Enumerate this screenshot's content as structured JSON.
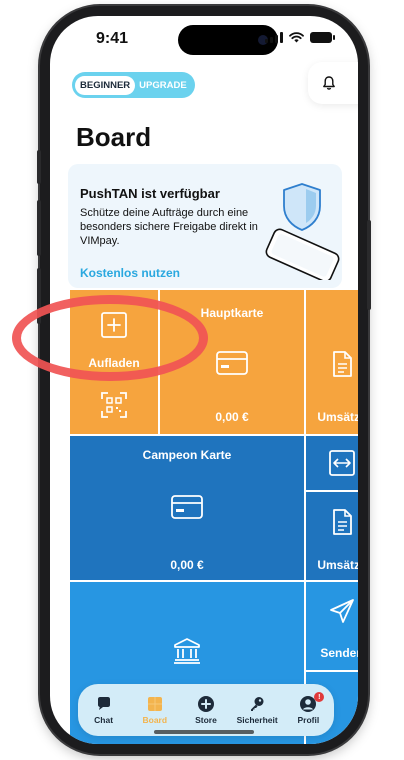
{
  "status_bar": {
    "time": "9:41"
  },
  "level": {
    "current": "BEGINNER",
    "upgrade": "UPGRADE"
  },
  "page_title": "Board",
  "promo": {
    "title": "PushTAN ist verfügbar",
    "text": "Schütze deine Aufträge durch eine besonders sichere Freigabe direkt in VIMpay.",
    "link": "Kostenlos nutzen"
  },
  "tiles": {
    "aufladen": "Aufladen",
    "hauptkarte_title": "Hauptkarte",
    "hauptkarte_balance": "0,00 €",
    "umsaetze_1": "Umsätze",
    "campeon_title": "Campeon Karte",
    "campeon_balance": "0,00 €",
    "umsaetze_2": "Umsätze",
    "senden": "Senden"
  },
  "tabbar": [
    {
      "label": "Chat",
      "icon": "chat-icon"
    },
    {
      "label": "Board",
      "icon": "board-icon",
      "active": true
    },
    {
      "label": "Store",
      "icon": "plus-circle-icon"
    },
    {
      "label": "Sicherheit",
      "icon": "key-icon"
    },
    {
      "label": "Profil",
      "icon": "profile-icon",
      "badge": "!"
    }
  ],
  "colors": {
    "orange": "#f6a43e",
    "dark_blue": "#1f74be",
    "light_blue": "#2796e2",
    "accent_cyan": "#2aa8df",
    "annotation_red": "#f05454"
  }
}
